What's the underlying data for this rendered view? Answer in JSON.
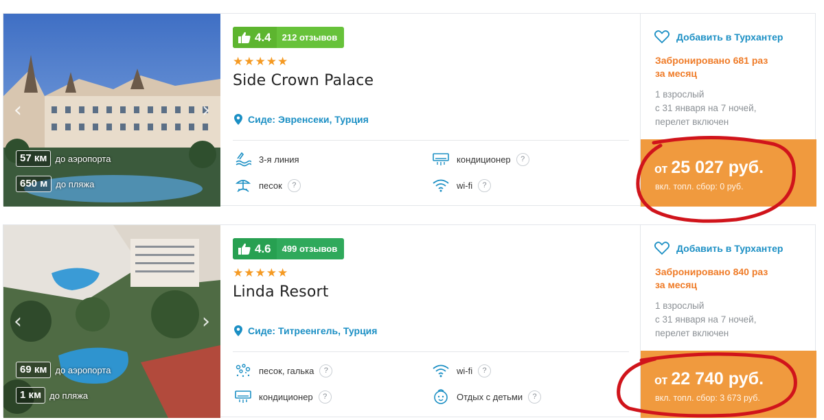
{
  "hotels": [
    {
      "rating": "4.4",
      "reviews": "212 отзывов",
      "stars": 5,
      "name": "Side Crown Palace",
      "location": "Сиде: Эвренсеки, Турция",
      "airport_distance": "57 км",
      "airport_label": "до аэропорта",
      "beach_distance": "650 м",
      "beach_label": "до пляжа",
      "features": [
        "3-я линия",
        "кондиционер",
        "песок",
        "wi-fi"
      ],
      "feature_icons": [
        "beach-line-icon",
        "air-conditioner-icon",
        "sand-icon",
        "wifi-icon"
      ],
      "add_label": "Добавить в Турхантер",
      "booked_line1": "Забронировано 681 раз",
      "booked_line2": "за месяц",
      "tour_line1": "1 взрослый",
      "tour_line2": "с 31 января на 7 ночей,",
      "tour_line3": "перелет включен",
      "price_prefix": "от ",
      "price_value": "25 027 руб.",
      "fee": "вкл. топл. сбор: 0 руб."
    },
    {
      "rating": "4.6",
      "reviews": "499 отзывов",
      "stars": 5,
      "name": "Linda Resort",
      "location": "Сиде: Титреенгель, Турция",
      "airport_distance": "69 км",
      "airport_label": "до аэропорта",
      "beach_distance": "1 км",
      "beach_label": "до пляжа",
      "features": [
        "песок, галька",
        "wi-fi",
        "кондиционер",
        "Отдых с детьми"
      ],
      "feature_icons": [
        "sand-pebble-icon",
        "wifi-icon",
        "air-conditioner-icon",
        "kids-icon"
      ],
      "add_label": "Добавить в Турхантер",
      "booked_line1": "Забронировано 840 раз",
      "booked_line2": "за месяц",
      "tour_line1": "1 взрослый",
      "tour_line2": "с 31 января на 7 ночей,",
      "tour_line3": "перелет включен",
      "price_prefix": "от ",
      "price_value": "22 740 руб.",
      "fee": "вкл. топл. сбор: 3 673 руб."
    }
  ],
  "colors": {
    "link": "#1b8fc4",
    "booked": "#ef7b27",
    "price_bg": "#f09a3e",
    "star": "#f59a23",
    "highlight_circle": "#d0141b"
  },
  "icons": {
    "star": "★",
    "help": "?",
    "prev": "‹",
    "next": "›"
  }
}
